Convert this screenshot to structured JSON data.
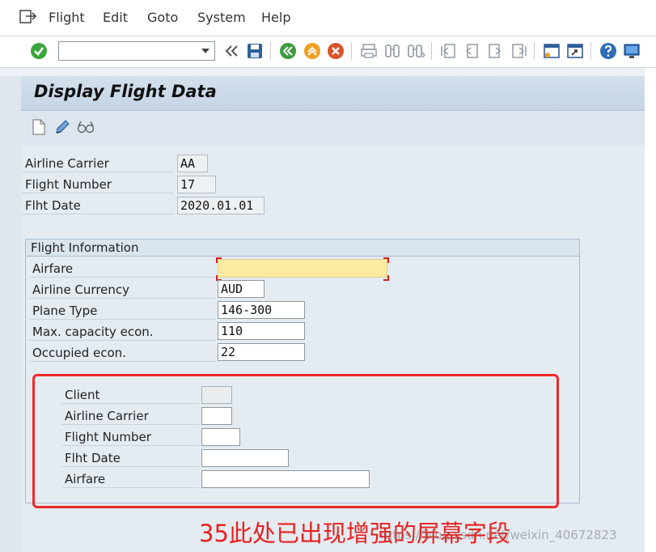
{
  "menu": {
    "items": [
      {
        "label": "Flight"
      },
      {
        "label": "Edit"
      },
      {
        "label": "Goto"
      },
      {
        "label": "System"
      },
      {
        "label": "Help"
      }
    ]
  },
  "toolbar": {
    "command_field_value": "",
    "icons": [
      "enter-icon",
      "back-chevrons-icon",
      "save-icon",
      "back-icon",
      "exit-icon",
      "cancel-icon",
      "print-icon",
      "find-icon",
      "find-next-icon",
      "first-page-icon",
      "previous-page-icon",
      "next-page-icon",
      "last-page-icon",
      "new-session-icon",
      "shortcut-icon",
      "help-icon",
      "customize-layout-icon"
    ]
  },
  "title": "Display Flight Data",
  "app_toolbar": {
    "icons": [
      "create-icon",
      "change-icon",
      "display-icon"
    ]
  },
  "header_fields": {
    "carrier": {
      "label": "Airline Carrier",
      "value": "AA"
    },
    "connid": {
      "label": "Flight Number",
      "value": "17"
    },
    "fldate": {
      "label": "Flht Date",
      "value": "2020.01.01"
    }
  },
  "flight_info": {
    "title": "Flight Information",
    "airfare": {
      "label": "Airfare",
      "value": ""
    },
    "currency": {
      "label": "Airline Currency",
      "value": "AUD"
    },
    "planetype": {
      "label": "Plane Type",
      "value": "146-300"
    },
    "seatsmax": {
      "label": "Max. capacity econ.",
      "value": "110"
    },
    "seatsocc": {
      "label": "Occupied econ.",
      "value": "22"
    }
  },
  "enhanced_fields": {
    "client": {
      "label": "Client",
      "value": ""
    },
    "carrier": {
      "label": "Airline Carrier",
      "value": ""
    },
    "connid": {
      "label": "Flight Number",
      "value": ""
    },
    "fldate": {
      "label": "Flht Date",
      "value": ""
    },
    "airfare": {
      "label": "Airfare",
      "value": ""
    }
  },
  "annotation": "35此处已出现增强的屏幕字段",
  "watermark": "https://blog.csdn.net/weixin_40672823",
  "colors": {
    "required_field": "#fbeaa0",
    "annotation_red": "#e8201f",
    "title_bar": "#c9d8e6"
  }
}
